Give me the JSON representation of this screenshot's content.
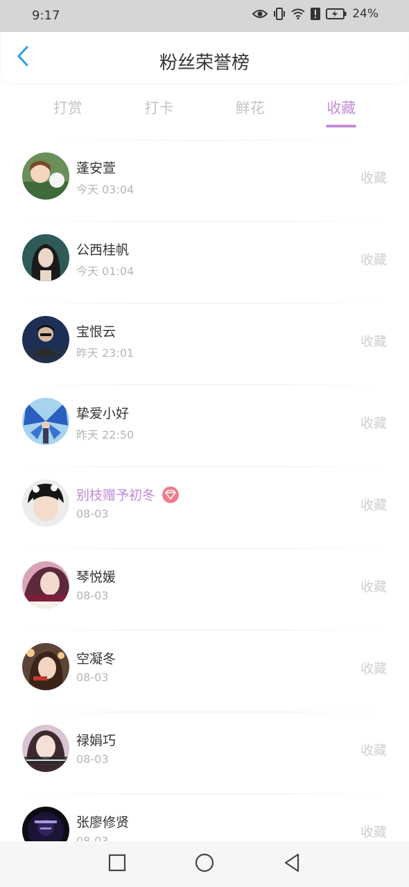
{
  "status_bar": {
    "time": "9:17",
    "battery": "24%",
    "icons": [
      "eye-icon",
      "vibrate-icon",
      "wifi-icon",
      "alert-icon",
      "battery-icon"
    ]
  },
  "header": {
    "title": "粉丝荣誉榜",
    "back_icon": "chevron-left-icon"
  },
  "tabs": [
    {
      "label": "打赏",
      "active": false
    },
    {
      "label": "打卡",
      "active": false
    },
    {
      "label": "鲜花",
      "active": false
    },
    {
      "label": "收藏",
      "active": true
    }
  ],
  "colors": {
    "accent": "#c68ed8",
    "back_arrow": "#2a9ee8",
    "badge": "#f07c8a",
    "muted_text": "#b5b5b5"
  },
  "list": [
    {
      "name": "蓬安萱",
      "time": "今天 03:04",
      "action": "收藏",
      "vip": false
    },
    {
      "name": "公西桂帆",
      "time": "今天 01:04",
      "action": "收藏",
      "vip": false
    },
    {
      "name": "宝恨云",
      "time": "昨天 23:01",
      "action": "收藏",
      "vip": false
    },
    {
      "name": "挚爱小好",
      "time": "昨天 22:50",
      "action": "收藏",
      "vip": false
    },
    {
      "name": "别枝赠予初冬",
      "time": "08-03",
      "action": "收藏",
      "vip": true
    },
    {
      "name": "琴悦媛",
      "time": "08-03",
      "action": "收藏",
      "vip": false
    },
    {
      "name": "空凝冬",
      "time": "08-03",
      "action": "收藏",
      "vip": false
    },
    {
      "name": "禄娟巧",
      "time": "08-03",
      "action": "收藏",
      "vip": false
    },
    {
      "name": "张廖修贤",
      "time": "08-03",
      "action": "收藏",
      "vip": false
    }
  ],
  "nav_bar": {
    "buttons": [
      "recent-apps-icon",
      "home-icon",
      "back-icon"
    ]
  }
}
